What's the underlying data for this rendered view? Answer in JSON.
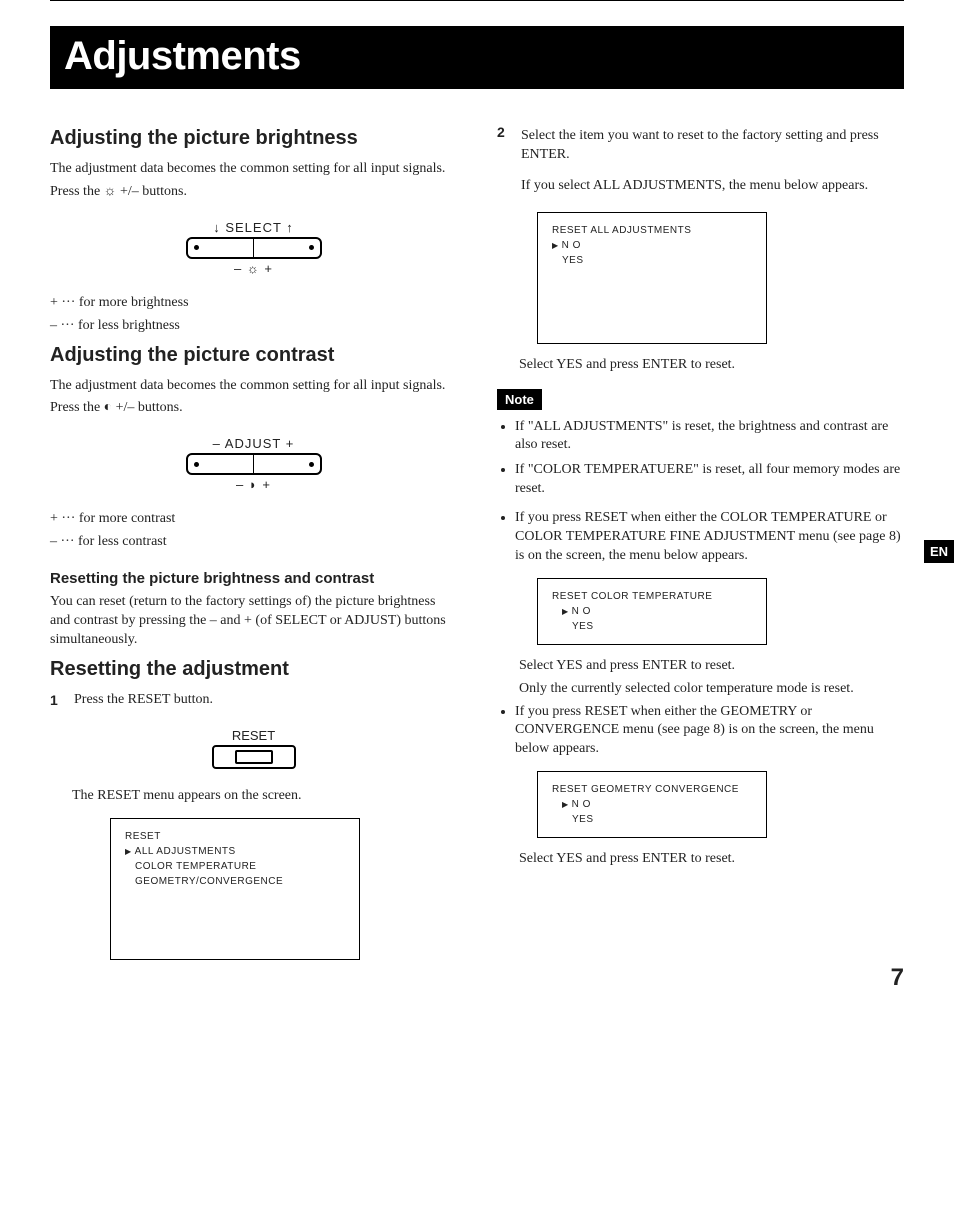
{
  "page": {
    "title": "Adjustments",
    "sideTab": "EN",
    "number": "7"
  },
  "left": {
    "brightness": {
      "heading": "Adjusting the picture brightness",
      "p1": "The adjustment data becomes the common setting for all input signals.",
      "p2": "Press the ☼ +/– buttons.",
      "diagramTop": "↓  SELECT  ↑",
      "diagramBottom": "–     ☼     +",
      "more": "+ ··· for more brightness",
      "less": "– ··· for less brightness"
    },
    "contrast": {
      "heading": "Adjusting the picture contrast",
      "p1": "The adjustment data becomes the common setting for all input signals.",
      "p2": "Press the ◐ +/– buttons.",
      "diagramTop": "–  ADJUST  +",
      "diagramBottom": "–     ◗     +",
      "more": "+ ··· for more contrast",
      "less": "– ··· for less contrast"
    },
    "resetBC": {
      "heading": "Resetting the picture brightness and contrast",
      "p": "You can reset (return to the factory settings of) the picture brightness and contrast by pressing the – and + (of SELECT or ADJUST) buttons simultaneously."
    },
    "resetAdj": {
      "heading": "Resetting the adjustment",
      "step1num": "1",
      "step1": "Press the RESET button.",
      "resetLabel": "RESET",
      "afterReset": "The RESET menu appears on the screen.",
      "osd": {
        "title": "RESET",
        "opt1": "ALL ADJUSTMENTS",
        "opt2": "COLOR TEMPERATURE",
        "opt3": "GEOMETRY/CONVERGENCE"
      }
    }
  },
  "right": {
    "step2num": "2",
    "step2a": "Select the item you want to reset to the factory setting and press ENTER.",
    "step2b": "If you select ALL ADJUSTMENTS, the menu below appears.",
    "osdAll": {
      "title": "RESET ALL ADJUSTMENTS",
      "no": "N O",
      "yes": "YES"
    },
    "selectYes": "Select YES and press ENTER to reset.",
    "noteLabel": "Note",
    "notes": {
      "n1": "If \"ALL ADJUSTMENTS\" is reset, the brightness and contrast are also reset.",
      "n2": "If \"COLOR TEMPERATUERE\" is reset, all four memory modes are reset."
    },
    "bullet1": "If you press RESET when either the COLOR TEMPERATURE or COLOR TEMPERATURE FINE ADJUSTMENT menu (see page 8) is on the screen, the menu below appears.",
    "osdCT": {
      "title": "RESET COLOR TEMPERATURE",
      "no": "N O",
      "yes": "YES"
    },
    "ctAfter1": "Select YES and press ENTER to reset.",
    "ctAfter2": "Only the currently selected color temperature mode is reset.",
    "bullet2": "If you press RESET when either the GEOMETRY or CONVERGENCE menu (see page 8) is on the screen, the menu below appears.",
    "osdGC": {
      "title": "RESET GEOMETRY  CONVERGENCE",
      "no": "N O",
      "yes": "YES"
    },
    "gcAfter": "Select YES and press ENTER to reset."
  }
}
